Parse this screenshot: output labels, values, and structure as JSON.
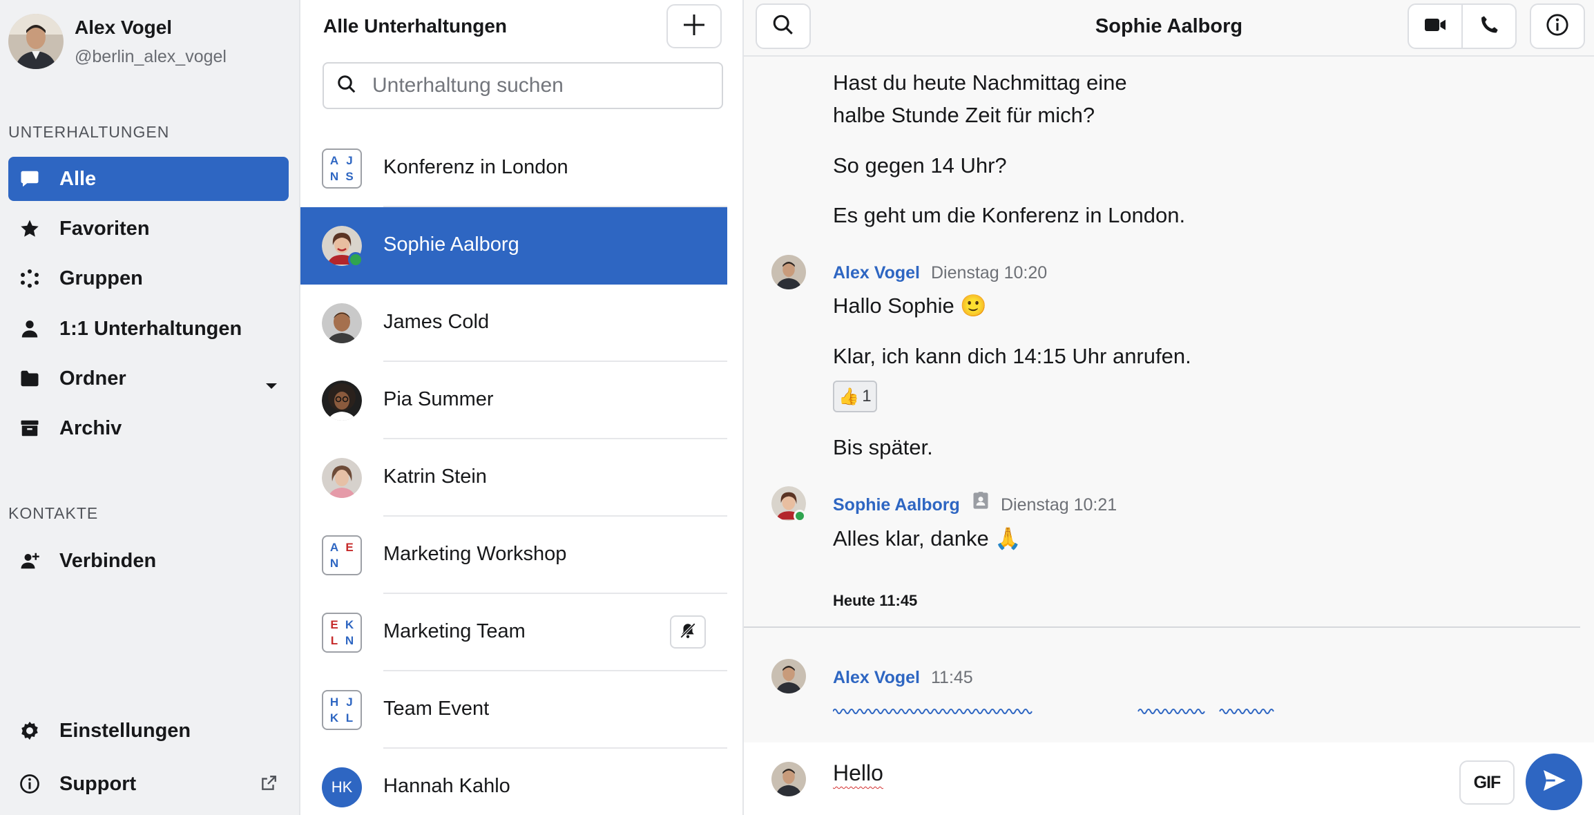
{
  "user": {
    "name": "Alex Vogel",
    "handle": "@berlin_alex_vogel"
  },
  "sidebar": {
    "conversations_label": "UNTERHALTUNGEN",
    "items": [
      {
        "label": "Alle",
        "icon": "chat-bubble-icon",
        "active": true
      },
      {
        "label": "Favoriten",
        "icon": "star-icon"
      },
      {
        "label": "Gruppen",
        "icon": "groups-icon"
      },
      {
        "label": "1:1 Unterhaltungen",
        "icon": "person-icon"
      },
      {
        "label": "Ordner",
        "icon": "folder-icon"
      },
      {
        "label": "Archiv",
        "icon": "archive-icon"
      }
    ],
    "contacts_label": "KONTAKTE",
    "connect_label": "Verbinden",
    "settings_label": "Einstellungen",
    "support_label": "Support"
  },
  "conversation_list": {
    "title": "Alle Unterhaltungen",
    "search_placeholder": "Unterhaltung suchen",
    "items": [
      {
        "name": "Konferenz in London",
        "type": "group",
        "initials": [
          "A",
          "J",
          "N",
          "S"
        ]
      },
      {
        "name": "Sophie Aalborg",
        "type": "person",
        "active": true,
        "online": true
      },
      {
        "name": "James Cold",
        "type": "person"
      },
      {
        "name": "Pia Summer",
        "type": "person"
      },
      {
        "name": "Katrin Stein",
        "type": "person"
      },
      {
        "name": "Marketing Workshop",
        "type": "group",
        "initials": [
          "A",
          "E",
          "N",
          ""
        ]
      },
      {
        "name": "Marketing Team",
        "type": "group",
        "initials": [
          "E",
          "K",
          "L",
          "N"
        ],
        "muted": true
      },
      {
        "name": "Team Event",
        "type": "group",
        "initials": [
          "H",
          "J",
          "K",
          "L"
        ]
      },
      {
        "name": "Hannah Kahlo",
        "type": "initials",
        "initials": "HK"
      }
    ]
  },
  "chat": {
    "title": "Sophie Aalborg",
    "messages_top": [
      "Hast du heute Nachmittag eine",
      "halbe Stunde Zeit für mich?",
      "So gegen 14 Uhr?",
      "Es geht um die Konferenz in London."
    ],
    "group_alex_1": {
      "author": "Alex Vogel",
      "time": "Dienstag 10:20",
      "messages": [
        "Hallo Sophie 🙂",
        "Klar, ich kann dich 14:15 Uhr anrufen.",
        "Bis später."
      ],
      "reaction_emoji": "👍",
      "reaction_count": "1"
    },
    "group_sophie": {
      "author": "Sophie Aalborg",
      "time": "Dienstag 10:21",
      "messages": [
        "Alles klar, danke 🙏"
      ]
    },
    "day_separator": "Heute 11:45",
    "group_alex_2": {
      "author": "Alex Vogel",
      "time": "11:45"
    },
    "composer_text": "Hello",
    "gif_label": "GIF"
  },
  "colors": {
    "accent": "#2e66c2",
    "online": "#2fa44f",
    "sidebar_bg": "#f0f1f3"
  }
}
